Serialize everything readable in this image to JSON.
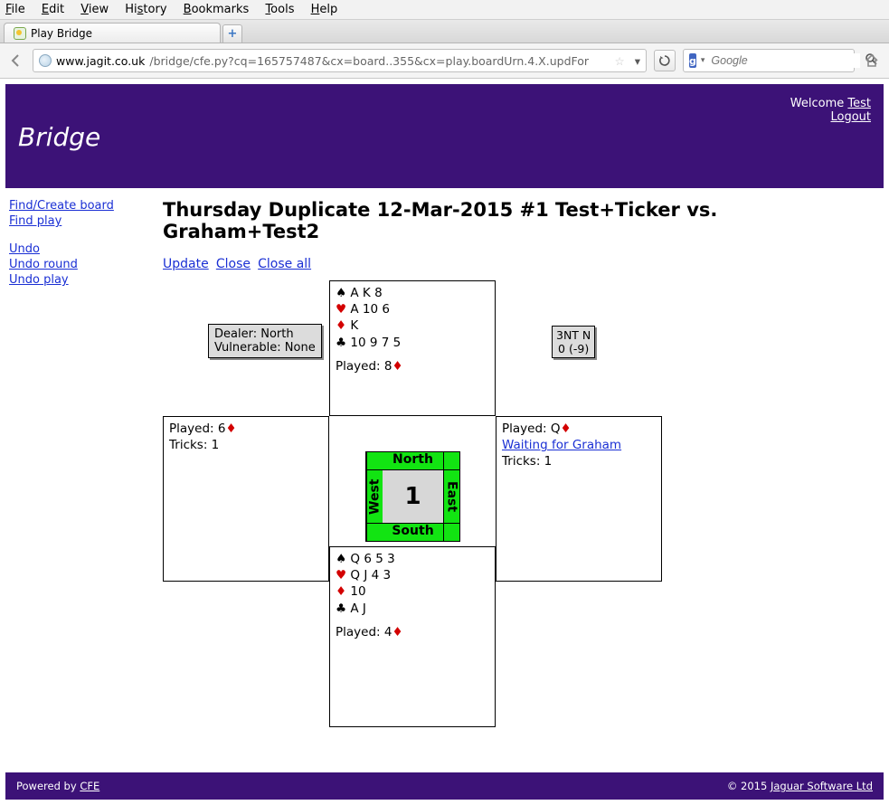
{
  "browser": {
    "menus": [
      "File",
      "Edit",
      "View",
      "History",
      "Bookmarks",
      "Tools",
      "Help"
    ],
    "tab_title": "Play Bridge",
    "url_host": "www.jagit.co.uk",
    "url_path": "/bridge/cfe.py?cq=165757487&cx=board..355&cx=play.boardUrn.4.X.updFor",
    "search_placeholder": "Google",
    "search_engine_letter": "g"
  },
  "banner": {
    "title": "Bridge",
    "welcome_text": "Welcome ",
    "user_link": "Test",
    "logout": "Logout"
  },
  "sidebar": {
    "find_create": "Find/Create board",
    "find_play": "Find play",
    "undo": "Undo",
    "undo_round": "Undo round",
    "undo_play": "Undo play"
  },
  "main": {
    "heading": "Thursday Duplicate 12-Mar-2015 #1 Test+Ticker vs. Graham+Test2",
    "action_update": "Update",
    "action_close": "Close",
    "action_close_all": "Close all"
  },
  "meta": {
    "dealer": "Dealer: North",
    "vulnerable": "Vulnerable: None"
  },
  "contract": {
    "line1": "3NT N",
    "line2": "0 (-9)"
  },
  "compass": {
    "n": "North",
    "s": "South",
    "w": "West",
    "e": "East",
    "num": "1"
  },
  "hands": {
    "north": {
      "spades": "A K 8",
      "hearts": "A 10 6",
      "diamonds": "K",
      "clubs": "10 9 7 5",
      "played_label": "Played: ",
      "played_card": "8",
      "played_suit": "♦"
    },
    "south": {
      "spades": "Q 6 5 3",
      "hearts": "Q J 4 3",
      "diamonds": "10",
      "clubs": "A J",
      "played_label": "Played: ",
      "played_card": "4",
      "played_suit": "♦"
    },
    "west": {
      "played_label": "Played: ",
      "played_card": "6",
      "played_suit": "♦",
      "tricks": "Tricks: 1"
    },
    "east": {
      "played_label": "Played: ",
      "played_card": "Q",
      "played_suit": "♦",
      "waiting": "Waiting for Graham",
      "tricks": "Tricks: 1"
    }
  },
  "footer": {
    "powered": "Powered by ",
    "powered_link": "CFE",
    "copyright": "© 2015 ",
    "company": "Jaguar Software Ltd"
  },
  "suits": {
    "spade": "♠",
    "heart": "♥",
    "diamond": "♦",
    "club": "♣"
  }
}
